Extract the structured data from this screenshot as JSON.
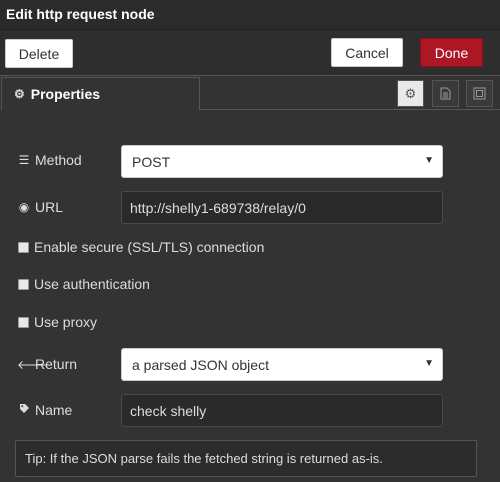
{
  "dialog": {
    "title": "Edit http request node"
  },
  "toolbar": {
    "delete_label": "Delete",
    "cancel_label": "Cancel",
    "done_label": "Done"
  },
  "tabs": {
    "properties_label": "Properties",
    "icon_tabs": [
      {
        "icon": "gear-icon",
        "active": true
      },
      {
        "icon": "document-icon",
        "active": false
      },
      {
        "icon": "frame-icon",
        "active": false
      }
    ]
  },
  "form": {
    "method": {
      "label": "Method",
      "value": "POST",
      "icon": "list-icon"
    },
    "url": {
      "label": "URL",
      "value": "http://shelly1-689738/relay/0",
      "icon": "globe-icon"
    },
    "ssl": {
      "label": "Enable secure (SSL/TLS) connection",
      "checked": false
    },
    "auth": {
      "label": "Use authentication",
      "checked": false
    },
    "proxy": {
      "label": "Use proxy",
      "checked": false
    },
    "return": {
      "label": "Return",
      "value": "a parsed JSON object",
      "icon": "arrow-left-icon"
    },
    "name": {
      "label": "Name",
      "value": "check shelly",
      "icon": "tag-icon"
    }
  },
  "tip": {
    "text": "Tip: If the JSON parse fails the fetched string is returned as-is."
  },
  "colors": {
    "done_button": "#ad1625",
    "background": "#333333",
    "input_dark": "#2a2a2a"
  }
}
